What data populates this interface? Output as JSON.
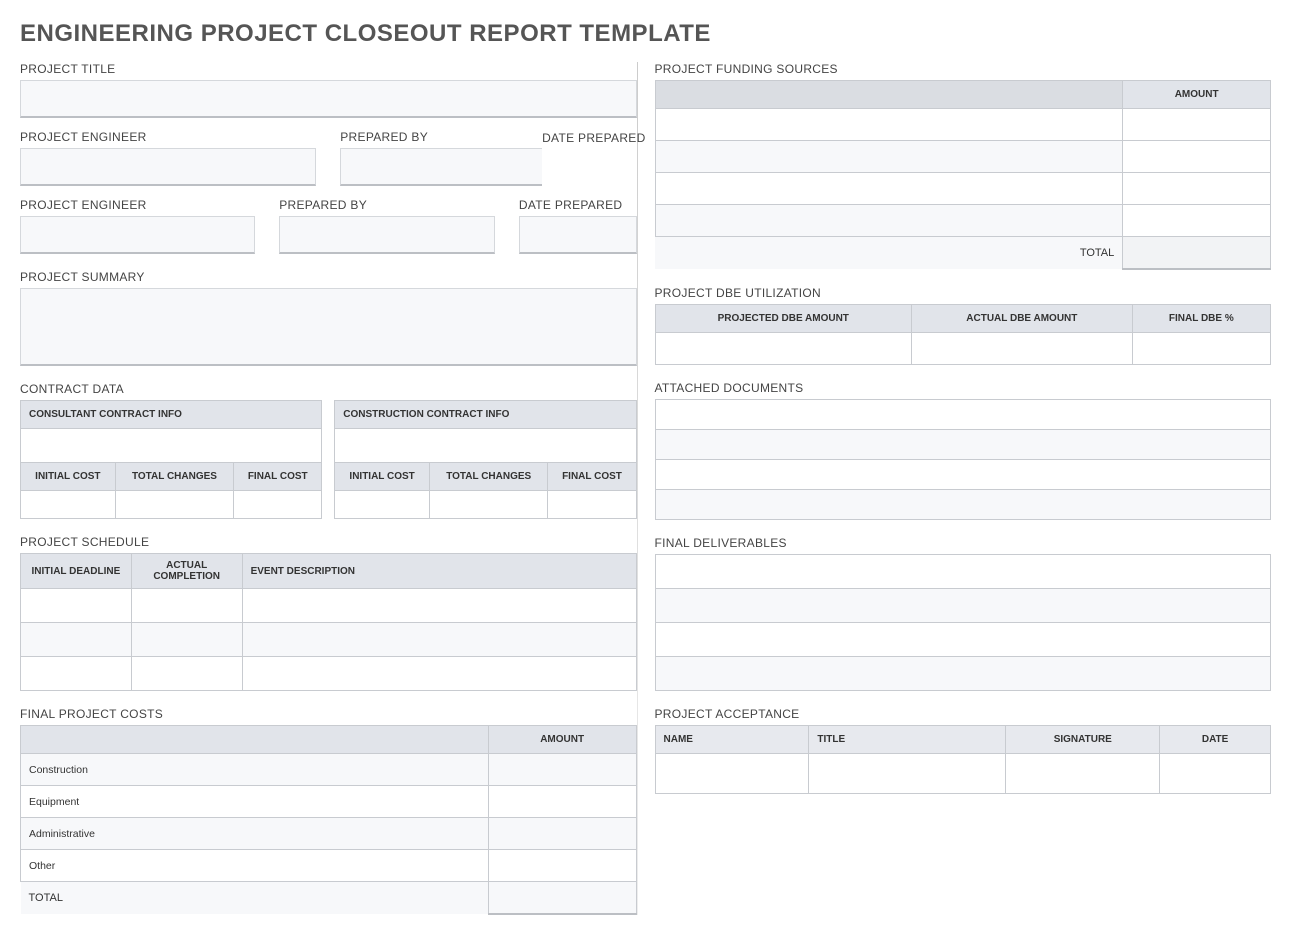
{
  "title": "ENGINEERING PROJECT CLOSEOUT REPORT TEMPLATE",
  "labels": {
    "project_title": "PROJECT TITLE",
    "project_engineer": "PROJECT ENGINEER",
    "prepared_by": "PREPARED BY",
    "date_prepared": "DATE PREPARED",
    "project_summary": "PROJECT SUMMARY",
    "contract_data": "CONTRACT DATA",
    "consultant_info": "CONSULTANT CONTRACT INFO",
    "construction_info": "CONSTRUCTION CONTRACT INFO",
    "initial_cost": "INITIAL COST",
    "total_changes": "TOTAL CHANGES",
    "final_cost": "FINAL COST",
    "project_schedule": "PROJECT SCHEDULE",
    "initial_deadline": "INITIAL DEADLINE",
    "actual_completion": "ACTUAL COMPLETION",
    "event_description": "EVENT DESCRIPTION",
    "final_project_costs": "FINAL PROJECT COSTS",
    "amount": "AMOUNT",
    "total": "TOTAL",
    "project_funding_sources": "PROJECT FUNDING SOURCES",
    "project_dbe": "PROJECT DBE UTILIZATION",
    "projected_dbe": "PROJECTED DBE AMOUNT",
    "actual_dbe": "ACTUAL DBE AMOUNT",
    "final_dbe_pct": "FINAL DBE %",
    "attached_documents": "ATTACHED DOCUMENTS",
    "final_deliverables": "FINAL DELIVERABLES",
    "project_acceptance": "PROJECT ACCEPTANCE",
    "name": "NAME",
    "title_col": "TITLE",
    "signature": "SIGNATURE",
    "date": "DATE"
  },
  "cost_rows": [
    "Construction",
    "Equipment",
    "Administrative",
    "Other"
  ],
  "values": {
    "project_title": "",
    "project_engineer": "",
    "prepared_by": "",
    "date_prepared": "",
    "project_summary": "",
    "consultant": {
      "info": "",
      "initial_cost": "",
      "total_changes": "",
      "final_cost": ""
    },
    "construction": {
      "info": "",
      "initial_cost": "",
      "total_changes": "",
      "final_cost": ""
    },
    "schedule": [
      {
        "initial": "",
        "actual": "",
        "desc": ""
      },
      {
        "initial": "",
        "actual": "",
        "desc": ""
      },
      {
        "initial": "",
        "actual": "",
        "desc": ""
      }
    ],
    "final_costs": {
      "Construction": "",
      "Equipment": "",
      "Administrative": "",
      "Other": "",
      "total": ""
    },
    "funding": [
      {
        "source": "",
        "amount": ""
      },
      {
        "source": "",
        "amount": ""
      },
      {
        "source": "",
        "amount": ""
      },
      {
        "source": "",
        "amount": ""
      }
    ],
    "funding_total": "",
    "dbe": {
      "projected": "",
      "actual": "",
      "final_pct": ""
    },
    "attached": [
      "",
      "",
      "",
      ""
    ],
    "deliverables": [
      "",
      "",
      "",
      ""
    ],
    "acceptance": {
      "name": "",
      "title": "",
      "signature": "",
      "date": ""
    }
  }
}
